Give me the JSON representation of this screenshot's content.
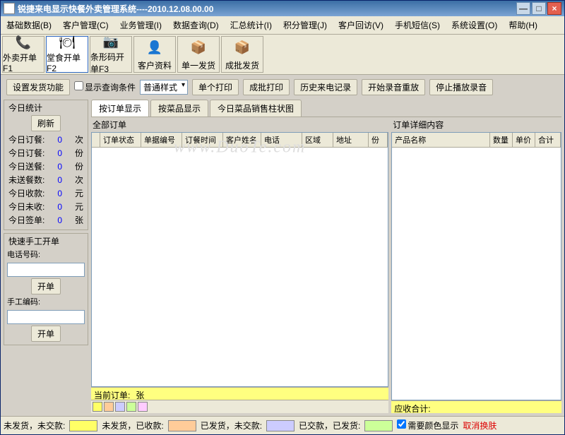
{
  "window": {
    "title": "锐捷来电显示快餐外卖管理系统----2010.12.08.00.00"
  },
  "menus": [
    "基础数据(B)",
    "客户管理(C)",
    "业务管理(I)",
    "数据查询(D)",
    "汇总统计(I)",
    "积分管理(J)",
    "客户回访(V)",
    "手机短信(S)",
    "系统设置(O)",
    "帮助(H)"
  ],
  "toolbar": [
    {
      "label": "外卖开单F1",
      "icon": "📞"
    },
    {
      "label": "堂食开单F2",
      "icon": "🍽"
    },
    {
      "label": "条形码开单F3",
      "icon": "📷"
    },
    {
      "label": "客户资料",
      "icon": "👤"
    },
    {
      "label": "单一发货",
      "icon": "📦"
    },
    {
      "label": "成批发货",
      "icon": "📦"
    }
  ],
  "controls": {
    "setup_btn": "设置发货功能",
    "show_query": "显示查询条件",
    "style_select": "普通样式",
    "btns": [
      "单个打印",
      "成批打印",
      "历史来电记录",
      "开始录音重放",
      "停止播放录音"
    ]
  },
  "today_stats": {
    "title": "今日统计",
    "refresh": "刷新",
    "rows": [
      {
        "label": "今日订餐:",
        "val": "0",
        "unit": "次"
      },
      {
        "label": "今日订餐:",
        "val": "0",
        "unit": "份"
      },
      {
        "label": "今日送餐:",
        "val": "0",
        "unit": "份"
      },
      {
        "label": "未送餐数:",
        "val": "0",
        "unit": "次"
      },
      {
        "label": "今日收款:",
        "val": "0",
        "unit": "元"
      },
      {
        "label": "今日未收:",
        "val": "0",
        "unit": "元"
      },
      {
        "label": "今日签单:",
        "val": "0",
        "unit": "张"
      }
    ]
  },
  "quick_order": {
    "title": "快速手工开单",
    "phone_label": "电话号码:",
    "open_btn": "开单",
    "manual_label": "手工编码:",
    "open_btn2": "开单"
  },
  "tabs": [
    "按订单显示",
    "按菜品显示",
    "今日菜品销售柱状图"
  ],
  "grid_left": {
    "title": "全部订单",
    "cols": [
      "订单状态",
      "单据编号",
      "订餐时间",
      "客户姓名",
      "电话",
      "区域",
      "地址",
      "份"
    ],
    "footer_label": "当前订单:",
    "footer_unit": "张"
  },
  "grid_right": {
    "title": "订单详细内容",
    "cols": [
      "产品名称",
      "数量",
      "单价",
      "合计"
    ],
    "footer_label": "应收合计:"
  },
  "watermark": "www.DuoTe.com",
  "bottom": {
    "items": [
      "未发货，未交款:",
      "未发货，已收款:",
      "已发货，未交款:",
      "已交款，已发货:"
    ],
    "colors": [
      "#ffff66",
      "#ffcc99",
      "#ccccff",
      "#ccff99"
    ],
    "color_check": "需要颜色显示",
    "cancel_skin": "取消换肤"
  }
}
